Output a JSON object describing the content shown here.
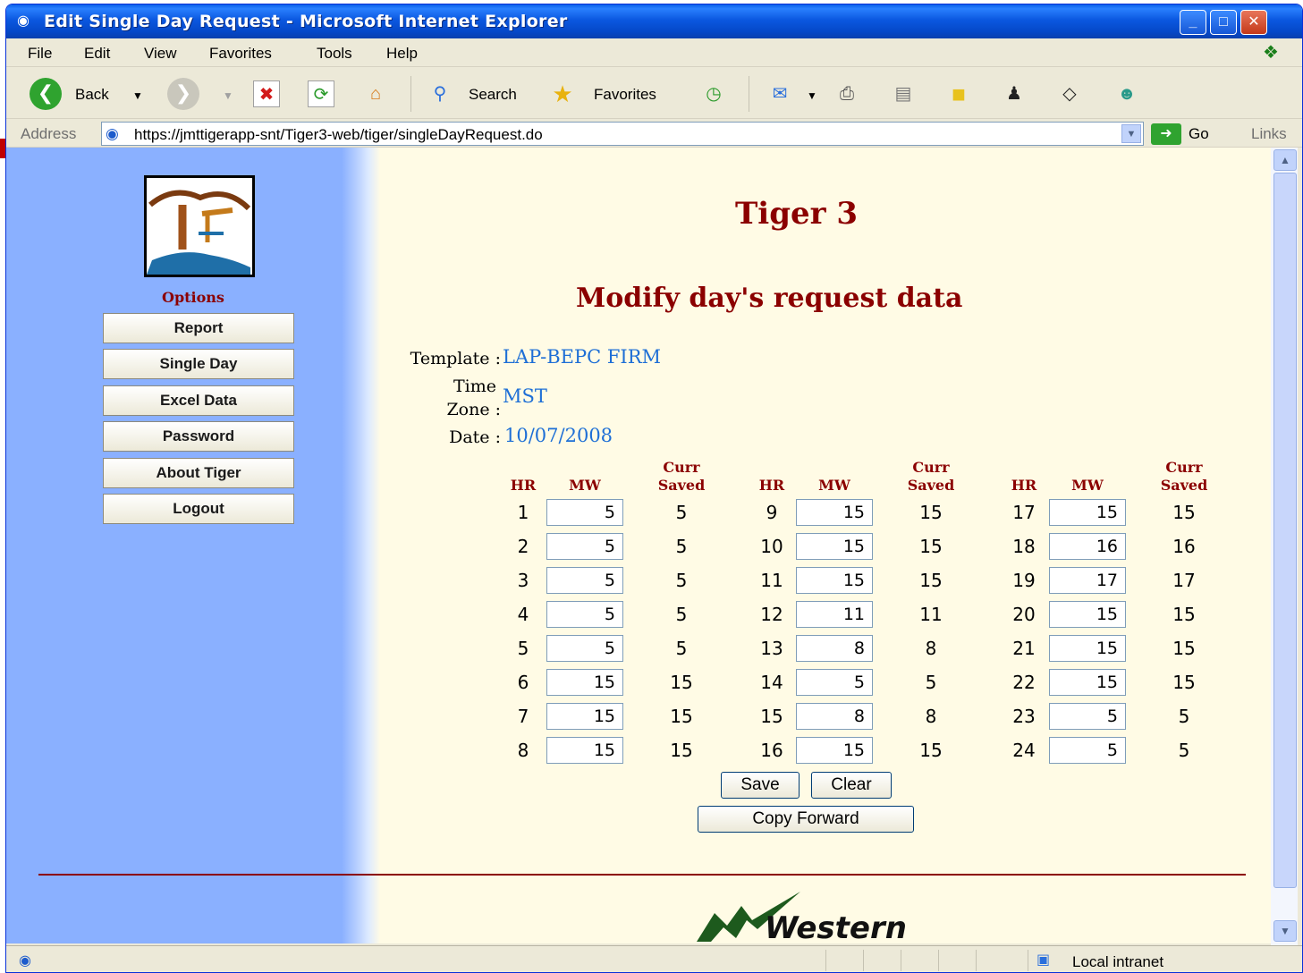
{
  "window": {
    "title": "Edit Single Day Request - Microsoft Internet Explorer"
  },
  "menu": [
    "File",
    "Edit",
    "View",
    "Favorites",
    "Tools",
    "Help"
  ],
  "toolbar": {
    "back": "Back",
    "search": "Search",
    "favorites": "Favorites"
  },
  "address": {
    "label": "Address",
    "url": "https://jmttigerapp-snt/Tiger3-web/tiger/singleDayRequest.do",
    "go": "Go",
    "links": "Links"
  },
  "sidebar": {
    "options_label": "Options",
    "buttons": [
      "Report",
      "Single Day",
      "Excel Data",
      "Password",
      "About Tiger",
      "Logout"
    ]
  },
  "page": {
    "title": "Tiger 3",
    "subtitle": "Modify day's request data",
    "template_label": "Template :",
    "template_value": "LAP-BEPC FIRM",
    "timezone_label_1": "Time",
    "timezone_label_2": "Zone :",
    "timezone_value": "MST",
    "date_label": "Date :",
    "date_value": "10/07/2008"
  },
  "grid": {
    "headers": {
      "hr": "HR",
      "mw": "MW",
      "curr": "Curr",
      "saved": "Saved"
    },
    "rows": [
      [
        "1",
        "5",
        "5",
        "9",
        "15",
        "15",
        "17",
        "15",
        "15"
      ],
      [
        "2",
        "5",
        "5",
        "10",
        "15",
        "15",
        "18",
        "16",
        "16"
      ],
      [
        "3",
        "5",
        "5",
        "11",
        "15",
        "15",
        "19",
        "17",
        "17"
      ],
      [
        "4",
        "5",
        "5",
        "12",
        "11",
        "11",
        "20",
        "15",
        "15"
      ],
      [
        "5",
        "5",
        "5",
        "13",
        "8",
        "8",
        "21",
        "15",
        "15"
      ],
      [
        "6",
        "15",
        "15",
        "14",
        "5",
        "5",
        "22",
        "15",
        "15"
      ],
      [
        "7",
        "15",
        "15",
        "15",
        "8",
        "8",
        "23",
        "5",
        "5"
      ],
      [
        "8",
        "15",
        "15",
        "16",
        "15",
        "15",
        "24",
        "5",
        "5"
      ]
    ]
  },
  "actions": {
    "save": "Save",
    "clear": "Clear",
    "copy_forward": "Copy Forward"
  },
  "footer": {
    "logo_text": "Western"
  },
  "status": {
    "zone": "Local intranet"
  }
}
